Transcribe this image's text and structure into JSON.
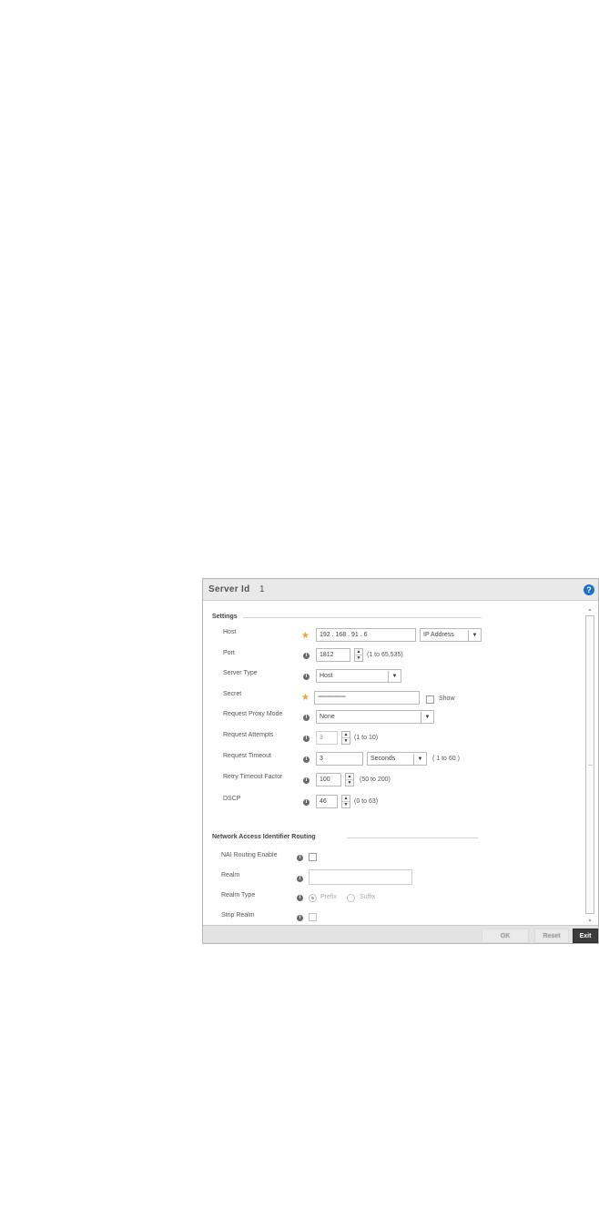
{
  "dialog": {
    "title": "Server Id",
    "server_id": "1",
    "help_glyph": "?"
  },
  "settings": {
    "section_title": "Settings",
    "host": {
      "label": "Host",
      "value": "192 . 168 . 91 . 6",
      "type_select": "IP Address"
    },
    "port": {
      "label": "Port",
      "value": "1812",
      "range": "(1 to 65,535)"
    },
    "server_type": {
      "label": "Server Type",
      "value": "Host"
    },
    "secret": {
      "label": "Secret",
      "value": "°°°°°°°°°°°°°°°°°°°",
      "show_label": "Show"
    },
    "proxy_mode": {
      "label": "Request Proxy Mode",
      "value": "None"
    },
    "attempts": {
      "label": "Request Attempts",
      "value": "3",
      "range": "(1 to 10)"
    },
    "timeout": {
      "label": "Request Timeout",
      "value": "3",
      "unit": "Seconds",
      "range": "( 1 to 60 )"
    },
    "retry_factor": {
      "label": "Retry Timeout Factor",
      "value": "100",
      "range": "(50 to 200)"
    },
    "dscp": {
      "label": "DSCP",
      "value": "46",
      "range": "(0 to 63)"
    }
  },
  "nai": {
    "section_title": "Network Access Identifier Routing",
    "enable": {
      "label": "NAI Routing Enable"
    },
    "realm": {
      "label": "Realm",
      "value": ""
    },
    "realm_type": {
      "label": "Realm Type",
      "prefix": "Prefix",
      "suffix": "Suffix",
      "selected": "Prefix"
    },
    "strip_realm": {
      "label": "Strip Realm"
    }
  },
  "footer": {
    "ok": "OK",
    "reset": "Reset",
    "exit": "Exit"
  },
  "icons": {
    "required": "★",
    "info": "i",
    "arrow_up": "▲",
    "arrow_down": "▼",
    "scroll_up": "▲",
    "scroll_down": "▼"
  },
  "colors": {
    "required_star": "#f0a030",
    "help_icon": "#1e6fd0",
    "exit_button": "#3c3c3c"
  }
}
